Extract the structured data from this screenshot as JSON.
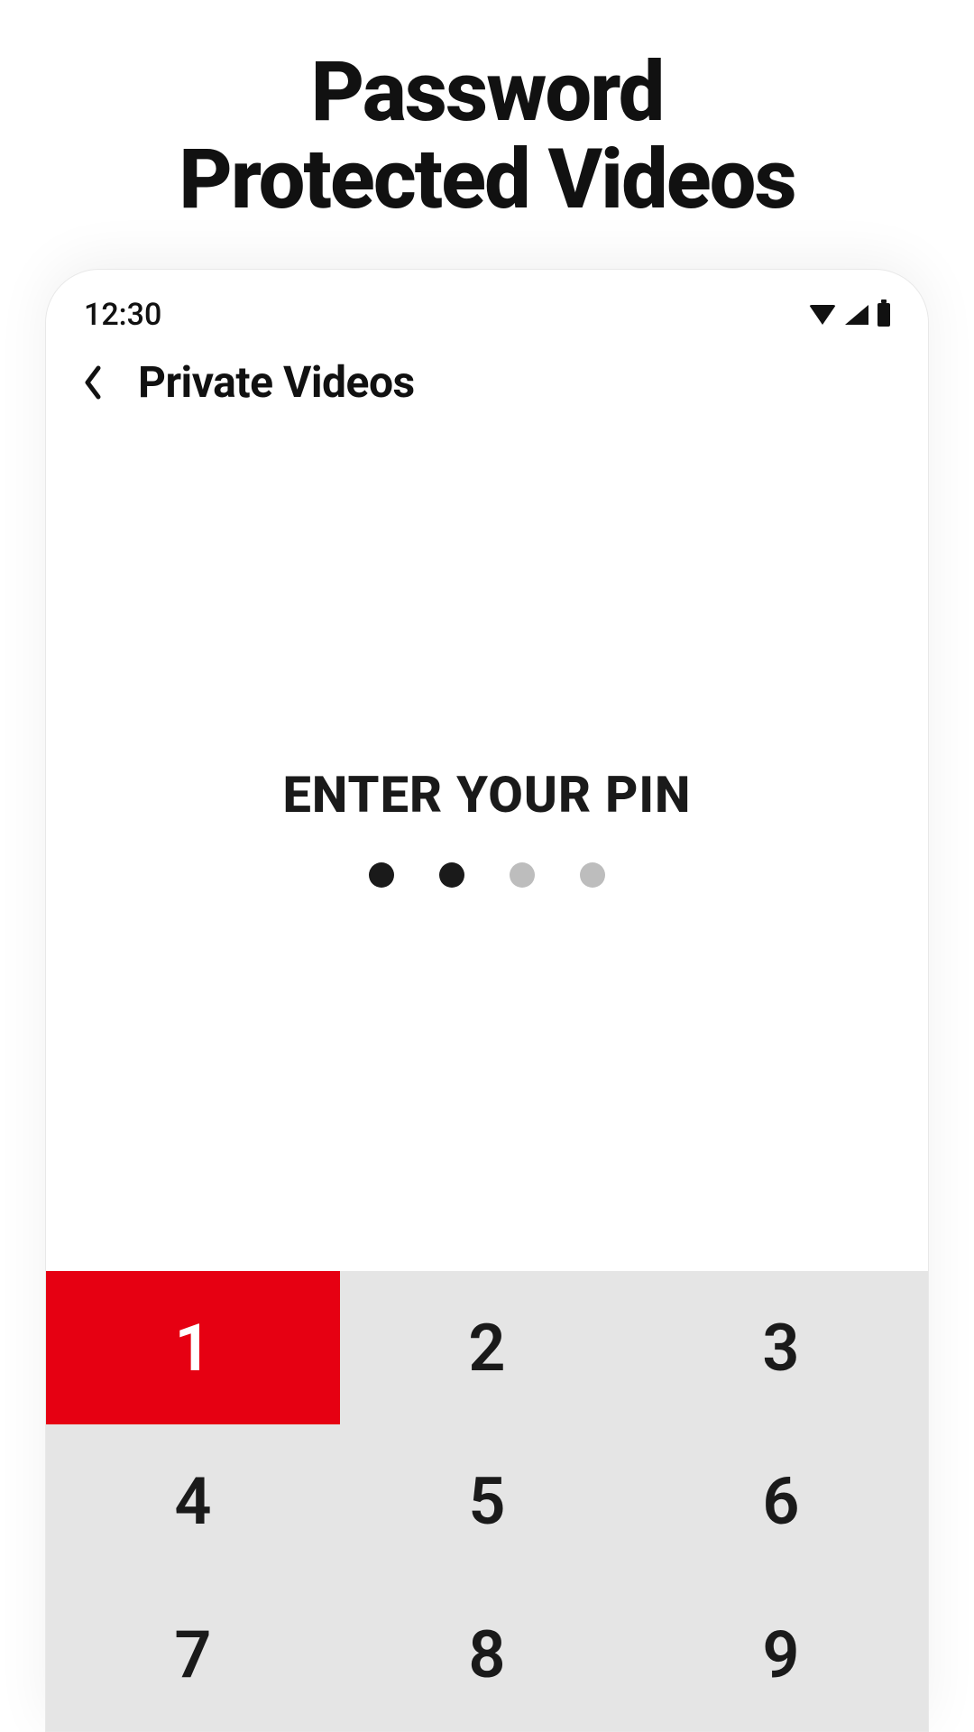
{
  "marketing": {
    "title_line1": "Password",
    "title_line2": "Protected Videos"
  },
  "status_bar": {
    "time": "12:30"
  },
  "header": {
    "screen_title": "Private Videos"
  },
  "pin_entry": {
    "prompt": "ENTER YOUR PIN",
    "dots": [
      {
        "filled": true
      },
      {
        "filled": true
      },
      {
        "filled": false
      },
      {
        "filled": false
      }
    ]
  },
  "keypad": {
    "keys": [
      {
        "label": "1",
        "active": true
      },
      {
        "label": "2",
        "active": false
      },
      {
        "label": "3",
        "active": false
      },
      {
        "label": "4",
        "active": false
      },
      {
        "label": "5",
        "active": false
      },
      {
        "label": "6",
        "active": false
      },
      {
        "label": "7",
        "active": false
      },
      {
        "label": "8",
        "active": false
      },
      {
        "label": "9",
        "active": false
      }
    ]
  }
}
